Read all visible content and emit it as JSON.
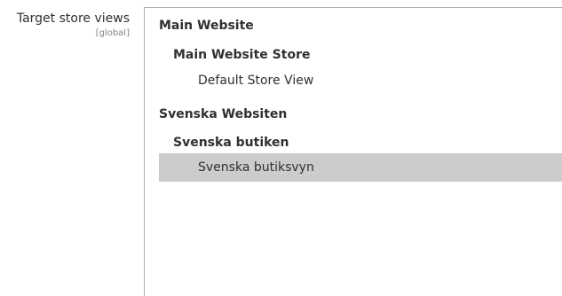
{
  "field": {
    "label": "Target store views",
    "scope": "[global]"
  },
  "store_views": {
    "groups": [
      {
        "website": "Main Website",
        "store": "Main Website Store",
        "view": "Default Store View",
        "view_selected": false
      },
      {
        "website": "Svenska Websiten",
        "store": "Svenska butiken",
        "view": "Svenska butiksvyn",
        "view_selected": true
      }
    ]
  },
  "colors": {
    "selected_background": "#cccccc",
    "border": "#adadad",
    "text": "#303030",
    "scope_text": "#808080"
  }
}
